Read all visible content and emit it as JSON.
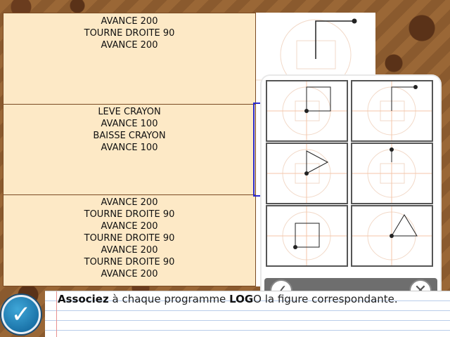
{
  "programs": [
    {
      "lines": [
        "AVANCE 200",
        "TOURNE DROITE 90",
        "AVANCE 200"
      ]
    },
    {
      "lines": [
        "LEVE CRAYON",
        "AVANCE 100",
        "BAISSE CRAYON",
        "AVANCE 100"
      ]
    },
    {
      "lines": [
        "AVANCE 200",
        "TOURNE DROITE 90",
        "AVANCE 200",
        "TOURNE DROITE 90",
        "AVANCE 200",
        "TOURNE DROITE 90",
        "AVANCE 200"
      ]
    }
  ],
  "instruction": {
    "part1": "Associez",
    "part2": " à chaque programme ",
    "part3": "LOG",
    "part4": "O la figure correspondante."
  },
  "chooser": {
    "ok_icon": "check-icon",
    "cancel_icon": "close-icon",
    "ok_glyph": "✓",
    "cancel_glyph": "✕"
  },
  "main_button": {
    "icon": "check-icon",
    "glyph": "✓"
  },
  "colors": {
    "program_bg": "#fde9c6",
    "selection": "#2a2ad0",
    "accent_blue": "#0c5e95"
  }
}
